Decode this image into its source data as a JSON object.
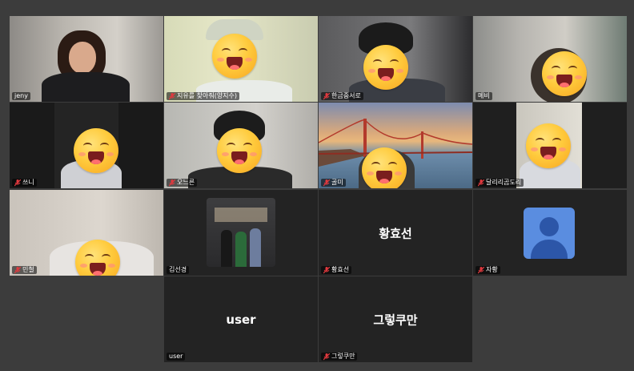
{
  "participants": [
    {
      "name": "jeny",
      "muted": false
    },
    {
      "name": "지유를 찾아줘(양지수)",
      "muted": true
    },
    {
      "name": "한금중서로",
      "muted": true
    },
    {
      "name": "메비",
      "muted": false
    },
    {
      "name": "쓰니",
      "muted": true
    },
    {
      "name": "오느른",
      "muted": true
    },
    {
      "name": "골미",
      "muted": true
    },
    {
      "name": "달리리곰도리",
      "muted": true
    },
    {
      "name": "민철",
      "muted": true
    },
    {
      "name": "김선경",
      "muted": false
    },
    {
      "name": "황효선",
      "muted": true,
      "display_name": "황효선"
    },
    {
      "name": "자황",
      "muted": true
    },
    {
      "name": "user",
      "muted": false,
      "display_name": "user"
    },
    {
      "name": "그렇쿠만",
      "muted": true,
      "display_name": "그렇쿠만"
    }
  ],
  "colors": {
    "active_speaker": "#27c26b",
    "muted_icon": "#e0393e",
    "avatar_bg": "#5a8de0"
  },
  "icons": {
    "muted": "mic-off-icon",
    "avatar": "person-avatar-icon",
    "emoji": "grinning-face-emoji"
  }
}
